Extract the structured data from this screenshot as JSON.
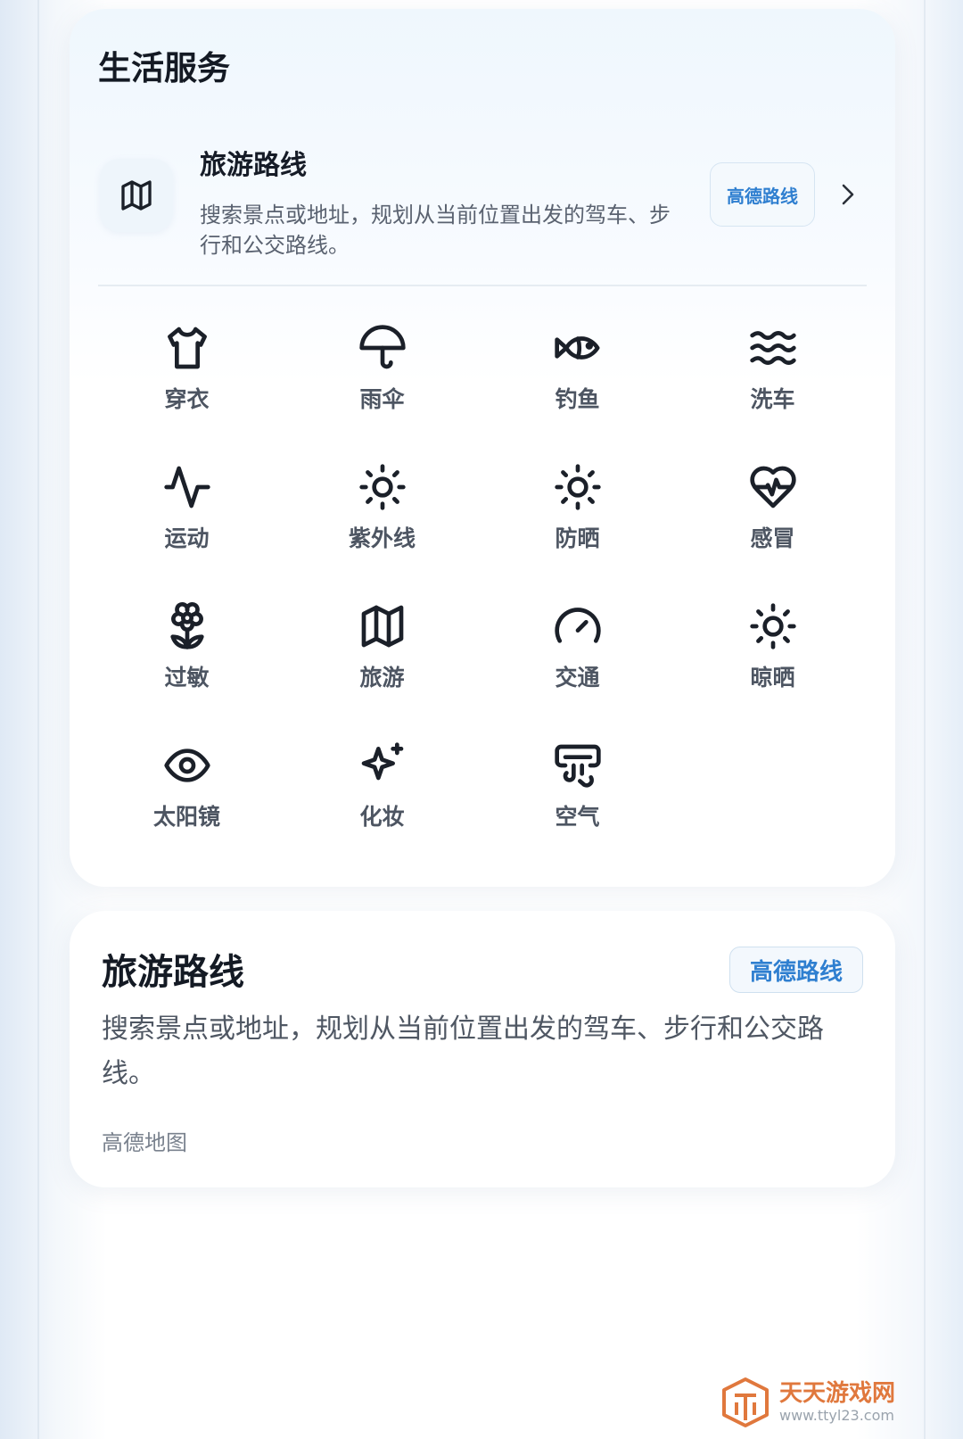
{
  "section": {
    "title": "生活服务"
  },
  "feature": {
    "icon": "map-icon",
    "title": "旅游路线",
    "description": "搜索景点或地址，规划从当前位置出发的驾车、步行和公交路线。",
    "badge": "高德路线",
    "chevron": "chevron-right-icon"
  },
  "grid": {
    "items": [
      {
        "label": "穿衣",
        "icon": "shirt-icon"
      },
      {
        "label": "雨伞",
        "icon": "umbrella-icon"
      },
      {
        "label": "钓鱼",
        "icon": "fish-icon"
      },
      {
        "label": "洗车",
        "icon": "waves-icon"
      },
      {
        "label": "运动",
        "icon": "activity-icon"
      },
      {
        "label": "紫外线",
        "icon": "sun-icon"
      },
      {
        "label": "防晒",
        "icon": "sun-icon"
      },
      {
        "label": "感冒",
        "icon": "heart-pulse-icon"
      },
      {
        "label": "过敏",
        "icon": "flower-icon"
      },
      {
        "label": "旅游",
        "icon": "map-icon"
      },
      {
        "label": "交通",
        "icon": "gauge-icon"
      },
      {
        "label": "晾晒",
        "icon": "sun-icon"
      },
      {
        "label": "太阳镜",
        "icon": "eye-icon"
      },
      {
        "label": "化妆",
        "icon": "sparkles-icon"
      },
      {
        "label": "空气",
        "icon": "air-vent-icon"
      }
    ]
  },
  "detail": {
    "title": "旅游路线",
    "badge": "高德路线",
    "description": "搜索景点或地址，规划从当前位置出发的驾车、步行和公交路线。",
    "source": "高德地图"
  },
  "watermark": {
    "title": "天天游戏网",
    "url": "www.ttyl23.com"
  },
  "colors": {
    "accent": "#2f7fd0",
    "text_primary": "#141a24",
    "text_secondary": "#4d5562",
    "watermark": "#e0783d"
  }
}
